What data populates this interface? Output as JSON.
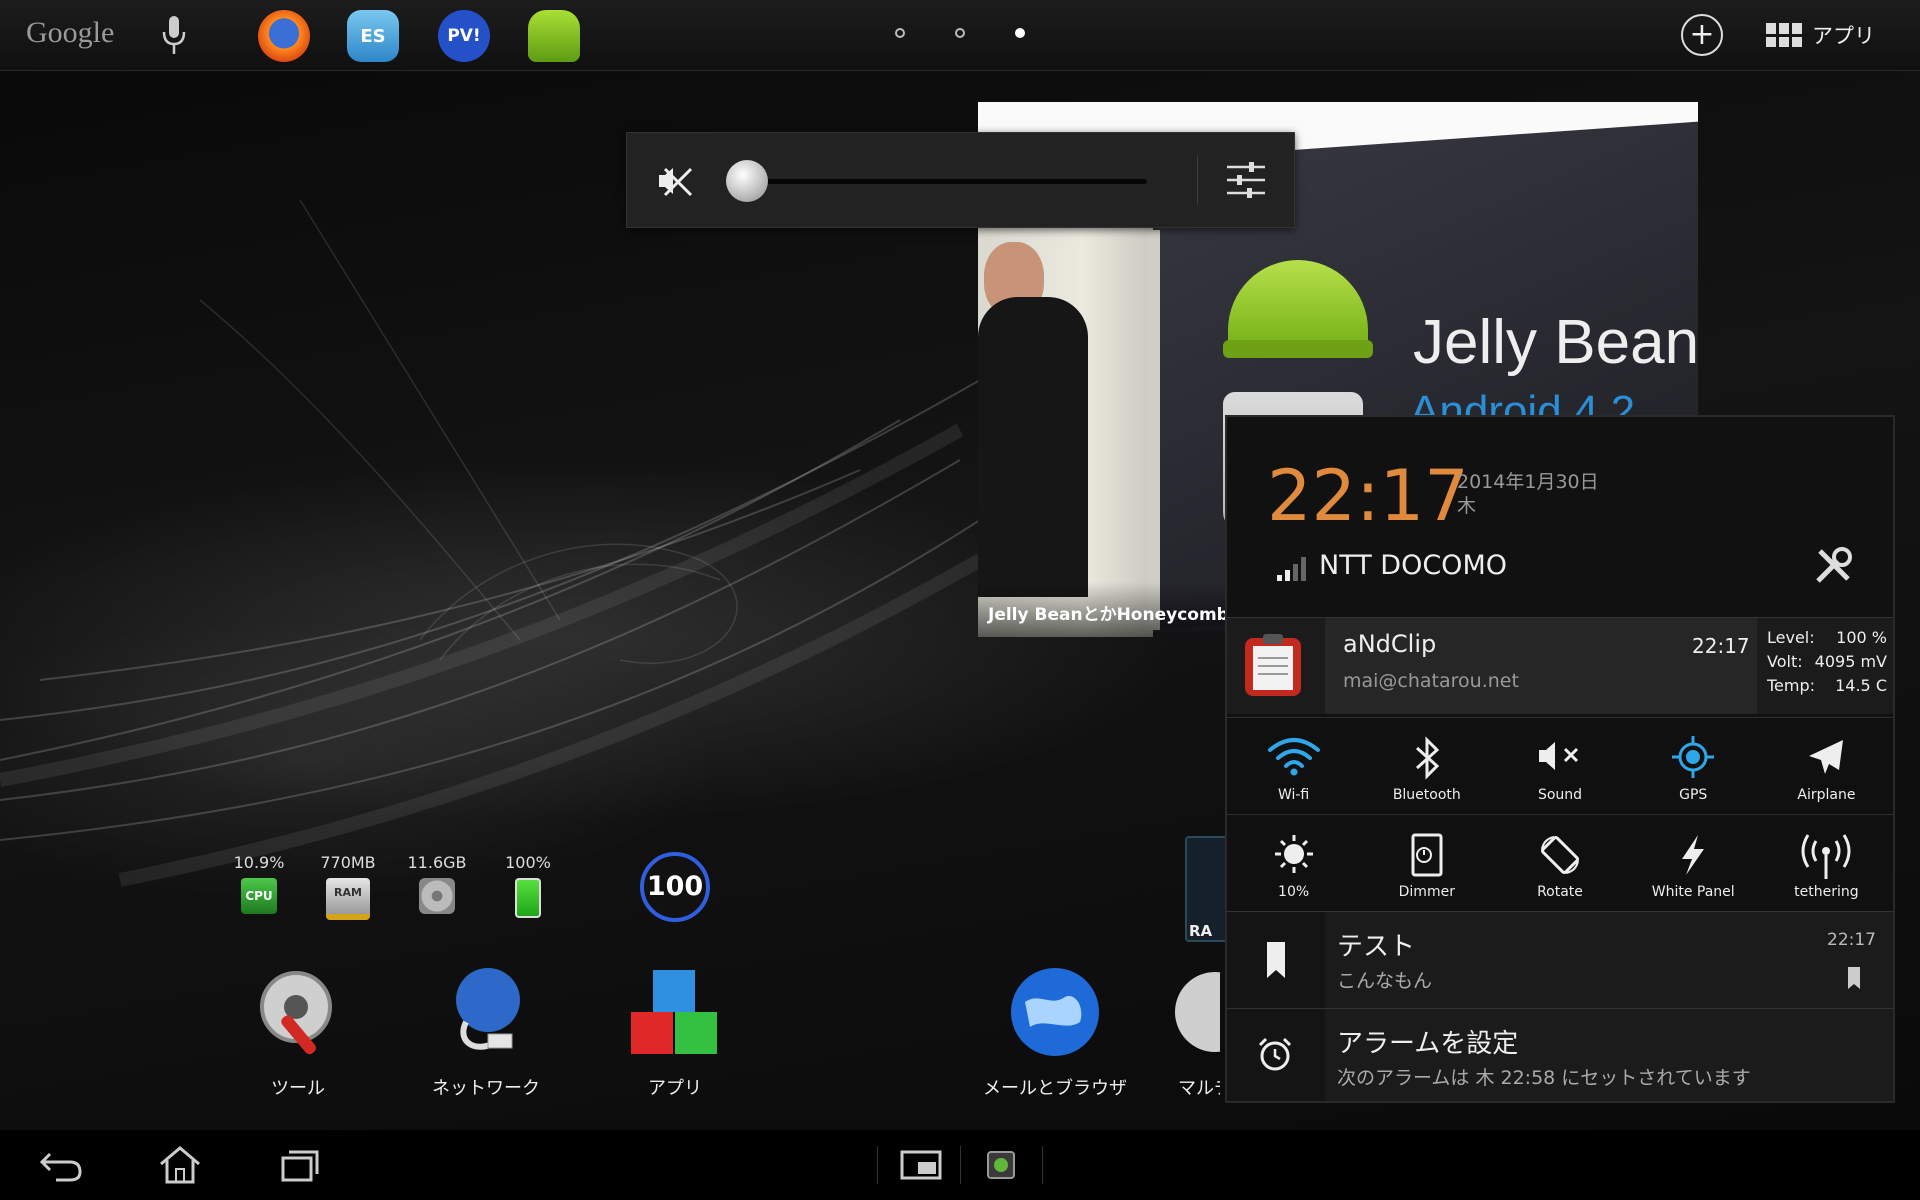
{
  "topbar": {
    "logo": "Google",
    "apps_label": "アプリ",
    "pinned_apps": [
      {
        "icon": "firefox-icon"
      },
      {
        "icon": "es-file-explorer-icon",
        "label": "ES"
      },
      {
        "icon": "pv-icon",
        "label": "PV!"
      },
      {
        "icon": "android-app-icon"
      }
    ]
  },
  "volume": {
    "level_percent": 0
  },
  "news_widget": {
    "title": "Jelly Bean",
    "subtitle": "Android 4.2",
    "caption": "Jelly BeanとかHoneycombと"
  },
  "system_widgets": {
    "cpu": {
      "value": "10.9%",
      "label": "CPU"
    },
    "ram": {
      "value": "770MB",
      "label": "RAM"
    },
    "storage": {
      "value": "11.6GB"
    },
    "battery": {
      "value": "100%"
    },
    "battery_circle": "100",
    "side_widget_label": "RA"
  },
  "dock": [
    {
      "label": "ツール",
      "icon": "tools-icon"
    },
    {
      "label": "ネットワーク",
      "icon": "network-icon"
    },
    {
      "label": "アプリ",
      "icon": "apps-cubes-icon"
    },
    {
      "label": "メールとブラウザ",
      "icon": "globe-icon"
    },
    {
      "label": "マルチ",
      "icon": "multimedia-icon"
    }
  ],
  "notification_panel": {
    "time": "22:17",
    "date": "2014年1月30日",
    "weekday": "木",
    "carrier": "NTT DOCOMO",
    "andclip": {
      "title": "aNdClip",
      "subtitle": "mai@chatarou.net",
      "time": "22:17"
    },
    "battery_info": [
      {
        "key": "Level:",
        "value": "100 %"
      },
      {
        "key": "Volt:",
        "value": "4095 mV"
      },
      {
        "key": "Temp:",
        "value": "14.5 C"
      }
    ],
    "quick_settings_row1": [
      {
        "label": "Wi-fi",
        "icon": "wifi-icon",
        "color": "#2fa6e8"
      },
      {
        "label": "Bluetooth",
        "icon": "bluetooth-icon",
        "color": "#eeeeee"
      },
      {
        "label": "Sound",
        "icon": "sound-muted-icon",
        "color": "#eeeeee"
      },
      {
        "label": "GPS",
        "icon": "gps-icon",
        "color": "#2fa6e8"
      },
      {
        "label": "Airplane",
        "icon": "airplane-icon",
        "color": "#eeeeee"
      }
    ],
    "quick_settings_row2": [
      {
        "label": "10%",
        "icon": "brightness-icon",
        "color": "#eeeeee"
      },
      {
        "label": "Dimmer",
        "icon": "dimmer-icon",
        "color": "#eeeeee"
      },
      {
        "label": "Rotate",
        "icon": "rotate-icon",
        "color": "#eeeeee"
      },
      {
        "label": "White Panel",
        "icon": "flash-icon",
        "color": "#eeeeee"
      },
      {
        "label": "tethering",
        "icon": "tethering-icon",
        "color": "#eeeeee"
      }
    ],
    "notifications": [
      {
        "title": "テスト",
        "subtitle": "こんなもん",
        "time": "22:17",
        "icon": "bookmark-icon"
      },
      {
        "title": "アラームを設定",
        "subtitle": "次のアラームは 木 22:58 にセットされています",
        "icon": "alarm-clock-icon"
      }
    ]
  }
}
